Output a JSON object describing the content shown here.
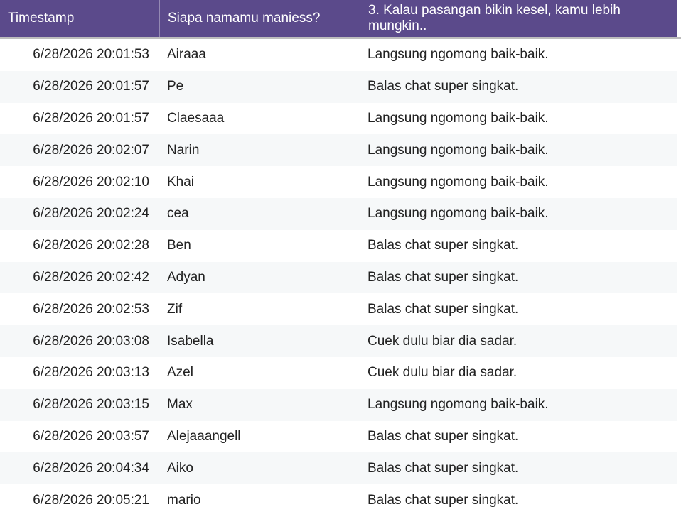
{
  "header": {
    "timestamp": "Timestamp",
    "name": "Siapa namamu maniess?",
    "question3": "3. Kalau pasangan bikin kesel, kamu lebih mungkin.."
  },
  "rows": [
    {
      "timestamp": "6/28/2026 20:01:53",
      "name": "Airaaa",
      "answer": "Langsung ngomong baik-baik."
    },
    {
      "timestamp": "6/28/2026 20:01:57",
      "name": "Pe",
      "answer": "Balas chat super singkat."
    },
    {
      "timestamp": "6/28/2026 20:01:57",
      "name": "Claesaaa",
      "answer": "Langsung ngomong baik-baik."
    },
    {
      "timestamp": "6/28/2026 20:02:07",
      "name": "Narin",
      "answer": "Langsung ngomong baik-baik."
    },
    {
      "timestamp": "6/28/2026 20:02:10",
      "name": "Khai",
      "answer": "Langsung ngomong baik-baik."
    },
    {
      "timestamp": "6/28/2026 20:02:24",
      "name": "cea",
      "answer": "Langsung ngomong baik-baik."
    },
    {
      "timestamp": "6/28/2026 20:02:28",
      "name": "Ben",
      "answer": "Balas chat super singkat."
    },
    {
      "timestamp": "6/28/2026 20:02:42",
      "name": "Adyan",
      "answer": "Balas chat super singkat."
    },
    {
      "timestamp": "6/28/2026 20:02:53",
      "name": "Zif",
      "answer": "Balas chat super singkat."
    },
    {
      "timestamp": "6/28/2026 20:03:08",
      "name": "Isabella",
      "answer": "Cuek dulu biar dia sadar."
    },
    {
      "timestamp": "6/28/2026 20:03:13",
      "name": "Azel",
      "answer": "Cuek dulu biar dia sadar."
    },
    {
      "timestamp": "6/28/2026 20:03:15",
      "name": "Max",
      "answer": "Langsung ngomong baik-baik."
    },
    {
      "timestamp": "6/28/2026 20:03:57",
      "name": "Alejaaangell",
      "answer": "Balas chat super singkat."
    },
    {
      "timestamp": "6/28/2026 20:04:34",
      "name": "Aiko",
      "answer": "Balas chat super singkat."
    },
    {
      "timestamp": "6/28/2026 20:05:21",
      "name": "mario",
      "answer": "Balas chat super singkat."
    }
  ],
  "colors": {
    "header_bg": "#5b4a8b",
    "header_text": "#ffffff",
    "row_alt_bg": "#f6f8f9"
  }
}
